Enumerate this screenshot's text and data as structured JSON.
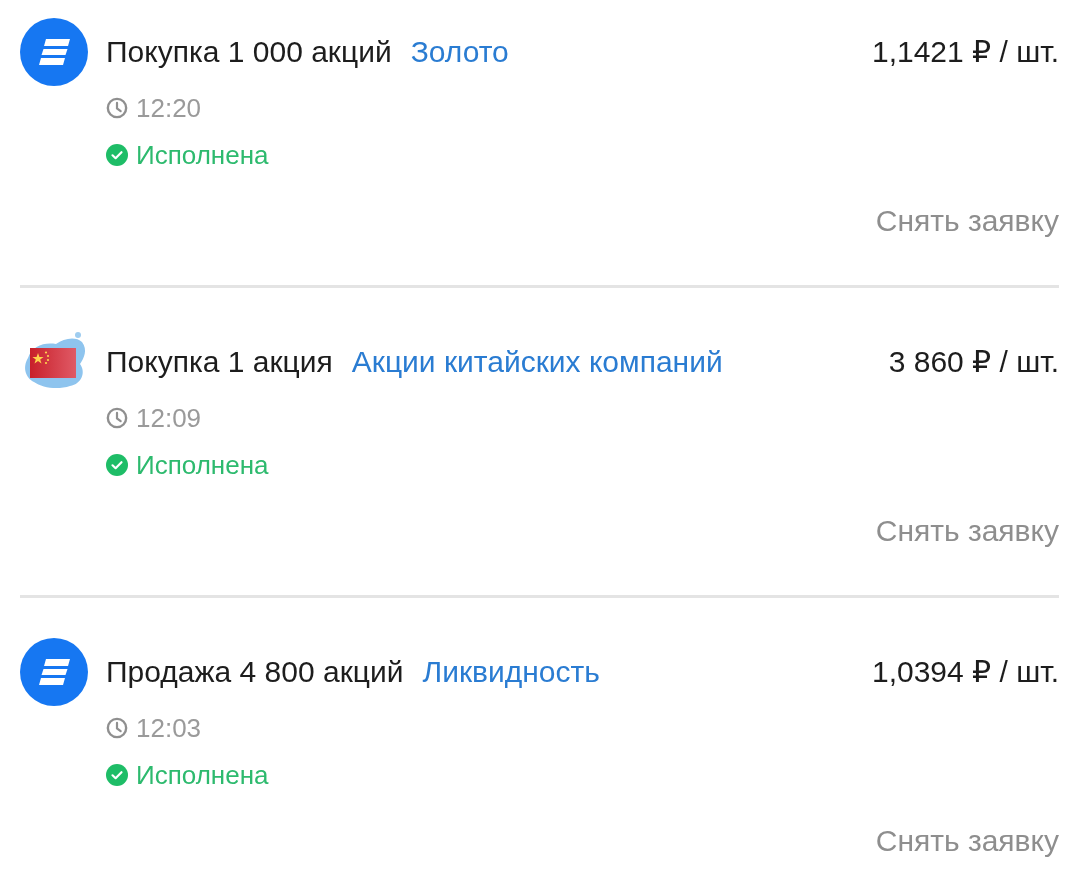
{
  "orders": [
    {
      "kind": "stripes",
      "title": "Покупка 1 000 акций",
      "instrument": "Золото",
      "price": "1,1421 ₽ / шт.",
      "time": "12:20",
      "status": "Исполнена",
      "cancel_button": {
        "label": "Снять заявку",
        "disabled": true
      }
    },
    {
      "kind": "flag",
      "title": "Покупка 1 акция",
      "instrument": "Акции китайских компаний",
      "price": "3 860 ₽ / шт.",
      "time": "12:09",
      "status": "Исполнена",
      "cancel_button": {
        "label": "Снять заявку",
        "disabled": true
      }
    },
    {
      "kind": "stripes",
      "title": "Продажа 4 800 акций",
      "instrument": "Ликвидность",
      "price": "1,0394 ₽ / шт.",
      "time": "12:03",
      "status": "Исполнена",
      "cancel_button": {
        "label": "Снять заявку",
        "disabled": true
      }
    }
  ]
}
